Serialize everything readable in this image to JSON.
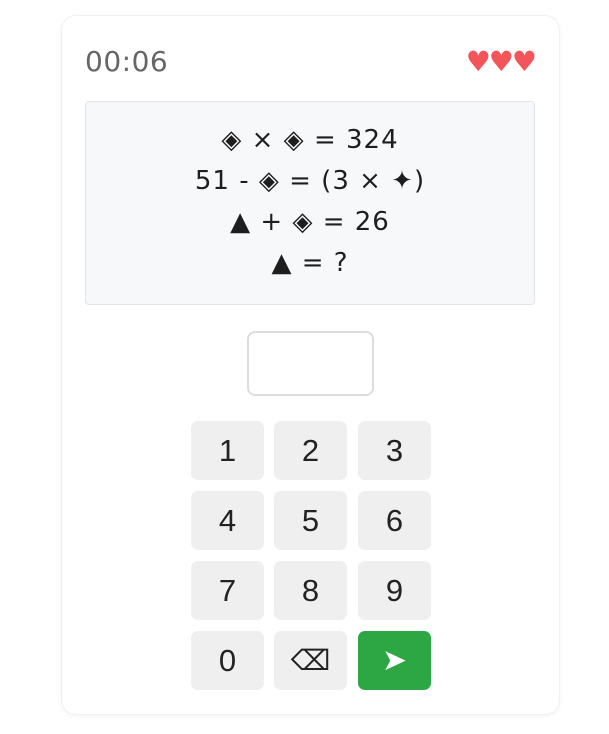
{
  "header": {
    "timer": "00:06",
    "lives": "♥♥♥"
  },
  "puzzle": {
    "lines": [
      "◈ × ◈ = 324",
      "51 - ◈ = (3 × ✦)",
      "▲ + ◈ = 26",
      "▲ = ?"
    ]
  },
  "answer": {
    "value": "",
    "placeholder": ""
  },
  "keypad": {
    "keys": [
      "1",
      "2",
      "3",
      "4",
      "5",
      "6",
      "7",
      "8",
      "9",
      "0"
    ],
    "backspace_glyph": "⌫",
    "submit_glyph": "➤",
    "backspace_icon": "backspace-icon",
    "submit_icon": "send-arrow-icon"
  },
  "colors": {
    "lives": "#f2555a",
    "submit": "#2ca744",
    "key_bg": "#efefef",
    "puzzle_bg": "#f7f8fa"
  }
}
